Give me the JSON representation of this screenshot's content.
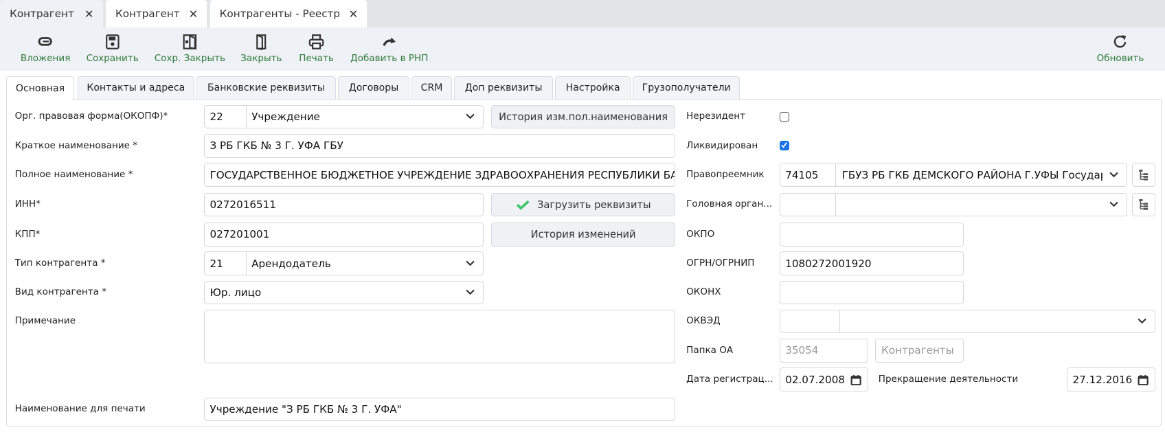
{
  "window_tabs": [
    {
      "label": "Контрагент",
      "active": true
    },
    {
      "label": "Контрагент"
    },
    {
      "label": "Контрагенты - Реестр"
    }
  ],
  "toolbar": {
    "attachments": "Вложения",
    "save": "Сохранить",
    "save_close": "Сохр. Закрыть",
    "close": "Закрыть",
    "print": "Печать",
    "add_rnp": "Добавить в РНП",
    "refresh": "Обновить",
    "label_color": "#2f7a3a"
  },
  "form_tabs": [
    "Основная",
    "Контакты и адреса",
    "Банковские реквизиты",
    "Договоры",
    "CRM",
    "Доп реквизиты",
    "Настройка",
    "Грузополучатели"
  ],
  "left": {
    "opf": {
      "label": "Орг. правовая форма(ОКОПФ)*",
      "code": "22",
      "value": "Учреждение"
    },
    "opf_history_button": "История изм.пол.наименования",
    "short_name": {
      "label": "Краткое наименование *",
      "value": "З РБ ГКБ № 3 Г. УФА ГБУ"
    },
    "full_name": {
      "label": "Полное наименование *",
      "value": "ГОСУДАРСТВЕННОЕ БЮДЖЕТНОЕ УЧРЕЖДЕНИЕ ЗДРАВООХРАНЕНИЯ РЕСПУБЛИКИ БАШКОРТОСТАН"
    },
    "inn": {
      "label": "ИНН*",
      "value": "0272016511"
    },
    "load_requisites_button": "Загрузить реквизиты",
    "kpp": {
      "label": "КПП*",
      "value": "027201001"
    },
    "history_button": "История изменений",
    "type": {
      "label": "Тип контрагента *",
      "code": "21",
      "value": "Арендодатель"
    },
    "kind": {
      "label": "Вид контрагента *",
      "value": "Юр. лицо"
    },
    "note": {
      "label": "Примечание",
      "value": ""
    },
    "print_name": {
      "label": "Наименование для печати",
      "value": "Учреждение \"З РБ ГКБ № 3 Г. УФА\""
    }
  },
  "right": {
    "nonresident": {
      "label": "Нерезидент",
      "checked": false
    },
    "liquidated": {
      "label": "Ликвидирован",
      "checked": true
    },
    "successor": {
      "label": "Правопреемник",
      "code": "74105",
      "value": "ГБУЗ РБ ГКБ ДЕМСКОГО РАЙОНА Г.УФЫ Государственное"
    },
    "head_org": {
      "label": "Головная орган...",
      "code": "",
      "value": ""
    },
    "okpo": {
      "label": "ОКПО",
      "value": ""
    },
    "ogrn": {
      "label": "ОГРН/ОГРНИП",
      "value": "1080272001920"
    },
    "okonh": {
      "label": "ОКОНХ",
      "value": ""
    },
    "okved": {
      "label": "ОКВЭД",
      "code": "",
      "value": ""
    },
    "folder": {
      "label": "Папка ОА",
      "code": "35054",
      "value": "Контрагенты"
    },
    "reg_date": {
      "label": "Дата регистрац...",
      "value": "02.07.2008"
    },
    "end_date": {
      "label": "Прекращение деятельности",
      "value": "27.12.2016"
    }
  }
}
